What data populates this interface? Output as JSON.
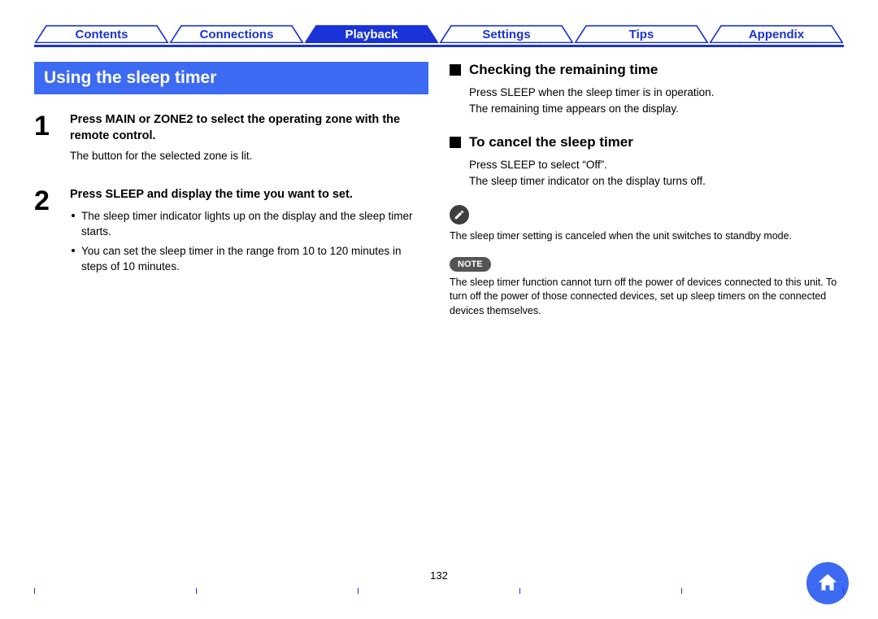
{
  "tabs": [
    {
      "label": "Contents",
      "active": false
    },
    {
      "label": "Connections",
      "active": false
    },
    {
      "label": "Playback",
      "active": true
    },
    {
      "label": "Settings",
      "active": false
    },
    {
      "label": "Tips",
      "active": false
    },
    {
      "label": "Appendix",
      "active": false
    }
  ],
  "left": {
    "title": "Using the sleep timer",
    "steps": [
      {
        "num": "1",
        "head": "Press MAIN or ZONE2 to select the operating zone with the remote control.",
        "sub": "The button for the selected zone is lit.",
        "bullets": []
      },
      {
        "num": "2",
        "head": "Press SLEEP and display the time you want to set.",
        "sub": "",
        "bullets": [
          "The sleep timer indicator lights up on the display and the sleep timer starts.",
          "You can set the sleep timer in the range from 10 to 120 minutes in steps of 10 minutes."
        ]
      }
    ]
  },
  "right": {
    "sections": [
      {
        "heading": "Checking the remaining time",
        "lines": [
          "Press SLEEP when the sleep timer is in operation.",
          "The remaining time appears on the display."
        ]
      },
      {
        "heading": "To cancel the sleep timer",
        "lines": [
          "Press SLEEP to select “Off”.",
          "The sleep timer indicator on the display turns off."
        ]
      }
    ],
    "info_text": "The sleep timer setting is canceled when the unit switches to standby mode.",
    "note_label": "NOTE",
    "note_text": "The sleep timer function cannot turn off the power of devices connected to this unit. To turn off the power of those connected devices, set up sleep timers on the connected devices themselves."
  },
  "page_number": "132"
}
